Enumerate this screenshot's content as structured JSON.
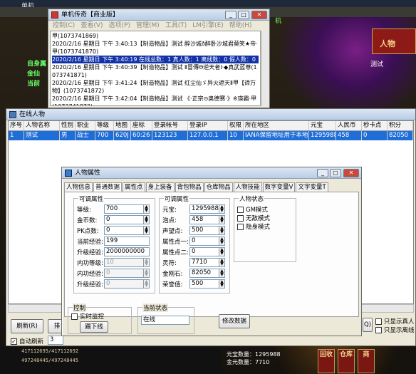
{
  "desktop": {
    "taskbar_text": "单机",
    "game_right_label": "机",
    "game_top_right": "人物",
    "game_right_mid": "测试",
    "left_labels": [
      "自身属",
      "金仙",
      "当前"
    ]
  },
  "logwin": {
    "title": "单机传奇【商业版】",
    "menu": [
      "控制(C)",
      "查看(V)",
      "选项(P)",
      "管理(M)",
      "工具(T)",
      "LM引擎(E)",
      "帮助(H)"
    ],
    "lines": [
      "甲(1073741869)",
      "2020/2/16 星期日 下午 3:40:13【制造物品】测试 醉沙城ð醉卧沙城君莫笑★帝·甲(1073741870)",
      "2020/2/16 星期日 下午 3:40:19 在线总数：1 真人数：1 离线数：0 假人数：0",
      "2020/2/16 星期日 下午 3:40:39【制造物品】测试 Ⅱ冒傳Θ逆天者Ⅰ·◆真武蓝尊(1073741871)",
      "2020/2/16 星期日 下午 3:41:24【制造物品】测试 红尘仙ゞ异火遮天Ⅱ甲【谛万物】(1073741872)",
      "2020/2/16 星期日 下午 3:42:04【制造物品】测试 《·正宗⊙奥德赛·》※瑛霸·甲(1073741873)"
    ],
    "selected_index": 2
  },
  "online": {
    "title": "在线人物",
    "columns": [
      "序号",
      "人物名称",
      "性别",
      "职业",
      "等级",
      "地图",
      "座标",
      "登录帐号",
      "登录IP",
      "权限",
      "所在地区",
      "元宝",
      "人民币",
      "秒卡点",
      "积分"
    ],
    "rows": [
      [
        "1",
        "测试",
        "男",
        "战士",
        "700",
        "620J",
        "60:26",
        "123123",
        "127.0.0.1",
        "10",
        "IANA保留地址用于本地回送",
        "1295988",
        "458",
        "0",
        "82050"
      ]
    ],
    "refresh_button": "刷新(R)",
    "sort_button": "排",
    "auto_refresh_label": "自动刷新",
    "auto_refresh_value": "3",
    "right_button": "Q)",
    "chk1": "只显示真人",
    "chk2": "只显示离线"
  },
  "attr": {
    "title": "人物属性",
    "tabs": [
      "人物信息",
      "普通数据",
      "属性点",
      "身上装备",
      "背包物品",
      "仓库物品",
      "人物技能",
      "数字变量V",
      "文字变量T"
    ],
    "active_tab": 1,
    "group1_title": "可调属性",
    "group1": [
      {
        "label": "等级:",
        "value": "700"
      },
      {
        "label": "金币数:",
        "value": "0"
      },
      {
        "label": "PK点数:",
        "value": "0"
      },
      {
        "label": "当前经验:",
        "value": "199"
      },
      {
        "label": "升级经验:",
        "value": "2000000000"
      },
      {
        "label": "内功等级:",
        "value": "10"
      },
      {
        "label": "内功经验:",
        "value": "0"
      },
      {
        "label": "升级经验:",
        "value": "0"
      }
    ],
    "group2_title": "可调属性",
    "group2": [
      {
        "label": "元宝:",
        "value": "1295988"
      },
      {
        "label": "泡点:",
        "value": "458"
      },
      {
        "label": "声望点:",
        "value": "500"
      },
      {
        "label": "属性点一:",
        "value": "0"
      },
      {
        "label": "属性点二:",
        "value": "0"
      },
      {
        "label": "灵符:",
        "value": "7710"
      },
      {
        "label": "金刚石:",
        "value": "82050"
      },
      {
        "label": "荣誉值:",
        "value": "500"
      }
    ],
    "group3_title": "人物状态",
    "status": [
      "GM模式",
      "无敌模式",
      "隐身模式"
    ],
    "control_title": "控制",
    "realtime_label": "实时监控",
    "kick_button": "踢下线",
    "state_title": "当前状态",
    "state_value": "在线",
    "modify_button": "修改数据"
  },
  "bottom": {
    "line1": "417112695/417112692",
    "line2": "497248445/497248445",
    "yuanbao": "元宝数量：1295988",
    "gold": "金元数量：7710",
    "buttons": [
      "回收",
      "仓库",
      "商"
    ]
  }
}
